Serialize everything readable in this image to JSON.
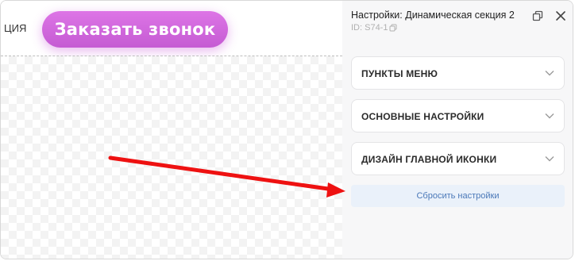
{
  "canvas": {
    "partial_text": "ЦИЯ",
    "cta_button_label": "Заказать звонок"
  },
  "panel": {
    "title": "Настройки: Динамическая секция 2",
    "id_text": "ID: S74-1",
    "sections": [
      {
        "label": "ПУНКТЫ МЕНЮ"
      },
      {
        "label": "ОСНОВНЫЕ НАСТРОЙКИ"
      },
      {
        "label": "ДИЗАЙН ГЛАВНОЙ ИКОНКИ"
      }
    ],
    "reset_label": "Сбросить настройки"
  },
  "icons": {
    "copy": "copy-icon",
    "restore": "restore-window-icon",
    "close": "close-icon",
    "chevron": "chevron-down-icon"
  },
  "colors": {
    "cta_button": "#cf66dc",
    "annotation_arrow": "#ee1111",
    "reset_text": "#4a78b8",
    "reset_bg": "#eaf1fa"
  }
}
